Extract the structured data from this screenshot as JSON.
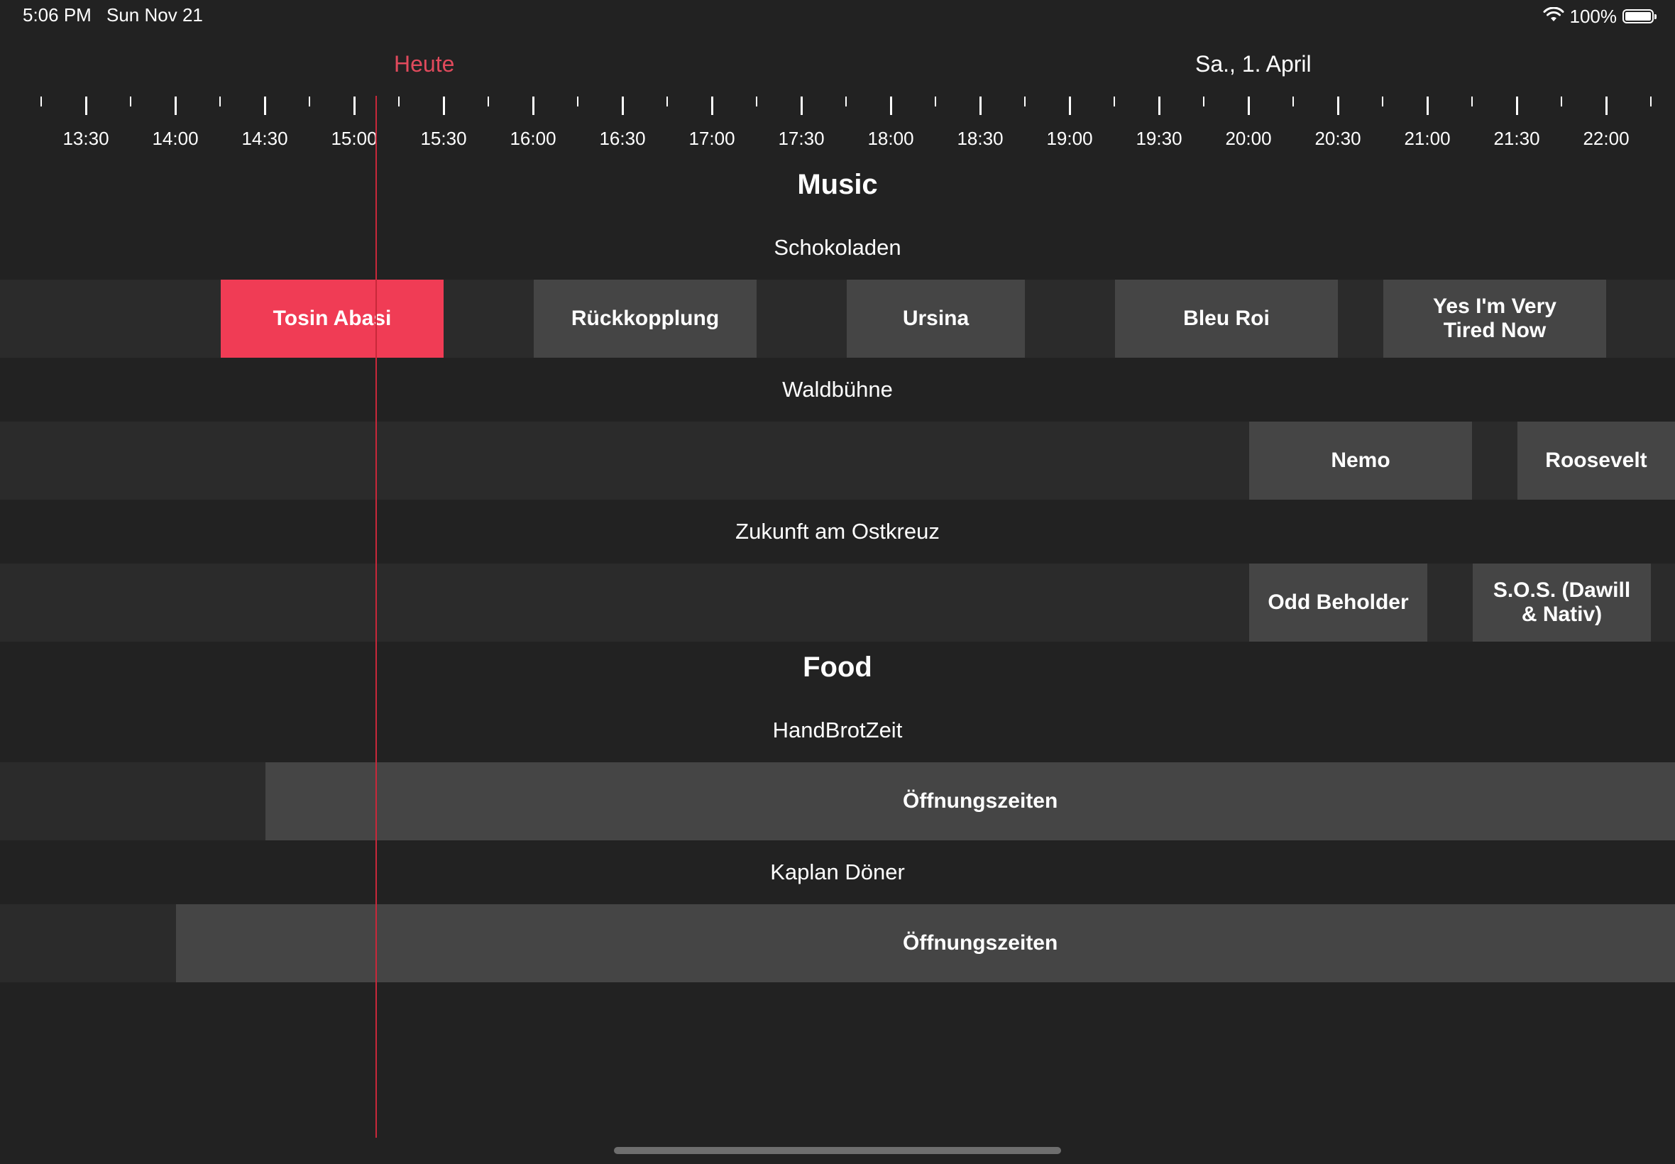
{
  "status_bar": {
    "time": "5:06 PM",
    "date": "Sun Nov 21",
    "battery": "100%"
  },
  "header": {
    "today_label": "Heute",
    "date_label": "Sa., 1. April"
  },
  "timeline": {
    "ticks": [
      "13:30",
      "14:00",
      "14:30",
      "15:00",
      "15:30",
      "16:00",
      "16:30",
      "17:00",
      "17:30",
      "18:00",
      "18:30",
      "19:00",
      "19:30",
      "20:00",
      "20:30",
      "21:00",
      "21:30",
      "22:00"
    ]
  },
  "sections": [
    {
      "title": "Music",
      "stages": [
        {
          "name": "Schokoladen",
          "events": [
            {
              "label": "Tosin Abasi",
              "live": true
            },
            {
              "label": "Rückkopplung"
            },
            {
              "label": "Ursina"
            },
            {
              "label": "Bleu Roi"
            },
            {
              "label": "Yes I'm Very Tired Now"
            }
          ]
        },
        {
          "name": "Waldbühne",
          "events": [
            {
              "label": "Nemo"
            },
            {
              "label": "Roosevelt"
            }
          ]
        },
        {
          "name": "Zukunft am Ostkreuz",
          "events": [
            {
              "label": "Odd Beholder"
            },
            {
              "label": "S.O.S. (Dawill & Nativ)"
            }
          ]
        }
      ]
    },
    {
      "title": "Food",
      "stages": [
        {
          "name": "HandBrotZeit",
          "events": [
            {
              "label": "Öffnungszeiten"
            }
          ]
        },
        {
          "name": "Kaplan Döner",
          "events": [
            {
              "label": "Öffnungszeiten"
            }
          ]
        }
      ]
    }
  ],
  "colors": {
    "background": "#222222",
    "lane": "#2b2b2b",
    "event": "#454545",
    "live_event": "#f03c55",
    "now_line": "#c8283a",
    "today_label": "#e04a5c"
  },
  "icons": [
    "wifi-icon",
    "battery-icon"
  ]
}
